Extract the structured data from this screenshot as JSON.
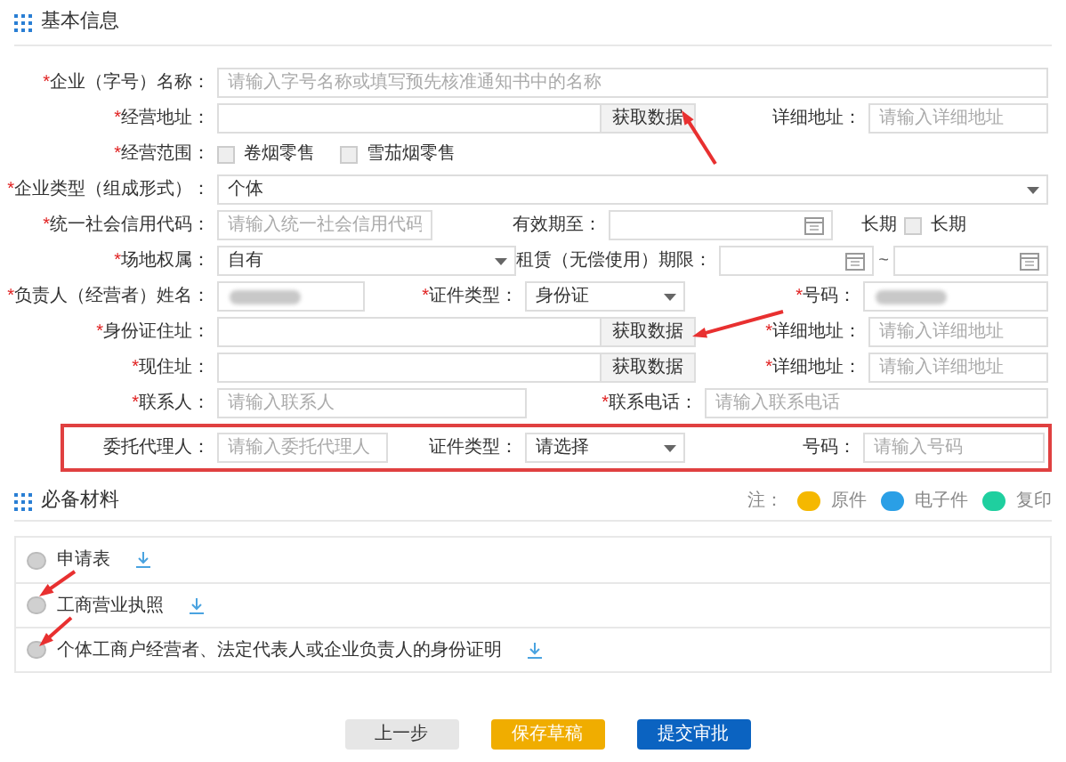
{
  "basic_info": {
    "title": "基本信息",
    "rows": [
      {
        "highlighted": false,
        "fields": [
          {
            "kind": "text",
            "mark": "*",
            "label": "企业（字号）名称：",
            "placeholder": "请输入字号名称或填写预先核准通知书中的名称"
          }
        ]
      },
      {
        "highlighted": false,
        "fields": [
          {
            "kind": "text_button",
            "mark": "*",
            "label": "经营地址：",
            "button": "获取数据"
          },
          {
            "kind": "text",
            "label": "详细地址：",
            "placeholder": "请输入详细地址"
          }
        ]
      },
      {
        "highlighted": false,
        "fields": [
          {
            "kind": "checkboxes",
            "mark": "*",
            "label": "经营范围：",
            "options": [
              {
                "label": "卷烟零售",
                "checked": false
              },
              {
                "label": "雪茄烟零售",
                "checked": false
              }
            ]
          }
        ]
      },
      {
        "highlighted": false,
        "fields": [
          {
            "kind": "select",
            "mark": "*",
            "label": "企业类型（组成形式）：",
            "value": "个体"
          }
        ]
      },
      {
        "highlighted": false,
        "fields": [
          {
            "kind": "text",
            "mark": "*",
            "label": "统一社会信用代码：",
            "placeholder": "请输入统一社会信用代码"
          },
          {
            "kind": "date",
            "label": "有效期至："
          },
          {
            "kind": "checkboxes",
            "label": "长期",
            "options": [
              {
                "label": "长期",
                "checked": false
              }
            ]
          }
        ]
      },
      {
        "highlighted": false,
        "fields": [
          {
            "kind": "select",
            "mark": "*",
            "label": "场地权属：",
            "value": "自有"
          },
          {
            "kind": "date_range",
            "label": "租赁（无偿使用）期限：",
            "separator": "~"
          }
        ]
      },
      {
        "highlighted": false,
        "fields": [
          {
            "kind": "text",
            "mark": "*",
            "label": "负责人（经营者）姓名：",
            "masked": true
          },
          {
            "kind": "select",
            "mark": "*",
            "label": "证件类型：",
            "value": "身份证"
          },
          {
            "kind": "text",
            "mark": "*",
            "label": "号码：",
            "masked": true
          }
        ]
      },
      {
        "highlighted": false,
        "fields": [
          {
            "kind": "text_button",
            "mark": "*",
            "label": "身份证住址：",
            "button": "获取数据"
          },
          {
            "kind": "text",
            "mark": "*",
            "label": "详细地址：",
            "placeholder": "请输入详细地址"
          }
        ]
      },
      {
        "highlighted": false,
        "fields": [
          {
            "kind": "text_button",
            "mark": "*",
            "label": "现住址：",
            "button": "获取数据"
          },
          {
            "kind": "text",
            "mark": "*",
            "label": "详细地址：",
            "placeholder": "请输入详细地址"
          }
        ]
      },
      {
        "highlighted": false,
        "fields": [
          {
            "kind": "text",
            "mark": "*",
            "label": "联系人：",
            "placeholder": "请输入联系人"
          },
          {
            "kind": "text",
            "mark": "*",
            "label": "联系电话：",
            "placeholder": "请输入联系电话"
          }
        ]
      },
      {
        "highlighted": true,
        "fields": [
          {
            "kind": "text",
            "label": "委托代理人：",
            "placeholder": "请输入委托代理人"
          },
          {
            "kind": "select",
            "label": "证件类型：",
            "value": "请选择"
          },
          {
            "kind": "text",
            "label": "号码：",
            "placeholder": "请输入号码"
          }
        ]
      }
    ]
  },
  "materials": {
    "title": "必备材料",
    "note": "注：",
    "legend": [
      {
        "label": "原件",
        "color": "#f5b800"
      },
      {
        "label": "电子件",
        "color": "#2a9fe6"
      },
      {
        "label": "复印",
        "color": "#1fcf9f"
      }
    ],
    "items": [
      {
        "label": "申请表"
      },
      {
        "label": "工商营业执照"
      },
      {
        "label": "个体工商户经营者、法定代表人或企业负责人的身份证明"
      }
    ]
  },
  "buttons": [
    {
      "label": "上一步",
      "kind": "secondary"
    },
    {
      "label": "保存草稿",
      "kind": "warning"
    },
    {
      "label": "提交审批",
      "kind": "primary"
    }
  ]
}
